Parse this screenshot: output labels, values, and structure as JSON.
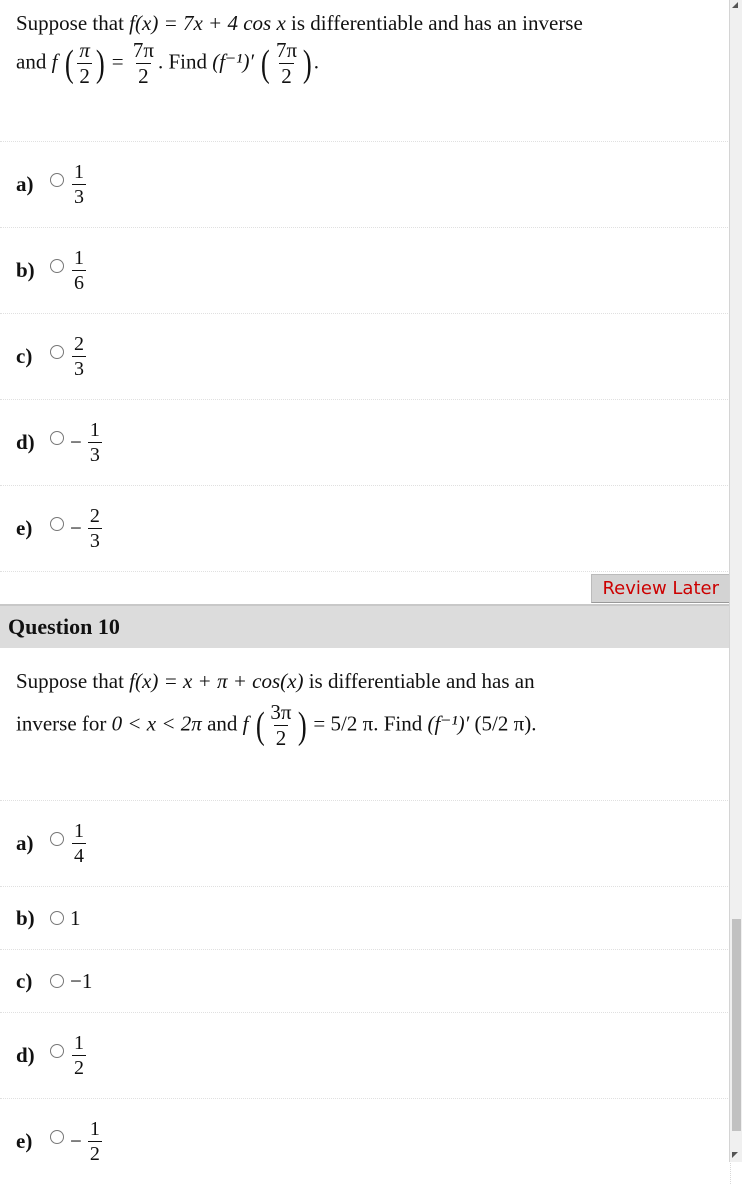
{
  "question9": {
    "stem_text_1": "Suppose that",
    "stem_func": "f(x) = 7x + 4 cos x",
    "stem_text_2": "is differentiable and has an inverse",
    "stem_line2_and": "and",
    "stem_f": "f",
    "stem_arg_num": "π",
    "stem_arg_den": "2",
    "stem_eq": "=",
    "stem_val_num": "7π",
    "stem_val_den": "2",
    "stem_find": ". Find",
    "stem_inv": "(f⁻¹)′",
    "stem_find_arg_num": "7π",
    "stem_find_arg_den": "2",
    "stem_end": ".",
    "options": [
      {
        "letter": "a)",
        "sign": "",
        "num": "1",
        "den": "3"
      },
      {
        "letter": "b)",
        "sign": "",
        "num": "1",
        "den": "6"
      },
      {
        "letter": "c)",
        "sign": "",
        "num": "2",
        "den": "3"
      },
      {
        "letter": "d)",
        "sign": "−",
        "num": "1",
        "den": "3"
      },
      {
        "letter": "e)",
        "sign": "−",
        "num": "2",
        "den": "3"
      }
    ]
  },
  "review_later_label": "Review Later",
  "question10": {
    "title": "Question 10",
    "stem_text_1": "Suppose that",
    "stem_func": "f(x) = x + π + cos(x)",
    "stem_text_2": "is differentiable and has an",
    "stem_line2_a": "inverse for",
    "stem_domain": "0 < x < 2π",
    "stem_and": "and",
    "stem_f": "f",
    "stem_arg_num": "3π",
    "stem_arg_den": "2",
    "stem_val": "= 5/2 π. Find",
    "stem_inv": "(f⁻¹)′",
    "stem_find_arg": "(5/2 π).",
    "options": [
      {
        "letter": "a)",
        "sign": "",
        "num": "1",
        "den": "4",
        "plain": ""
      },
      {
        "letter": "b)",
        "plain": "1"
      },
      {
        "letter": "c)",
        "plain": "−1"
      },
      {
        "letter": "d)",
        "sign": "",
        "num": "1",
        "den": "2",
        "plain": ""
      },
      {
        "letter": "e)",
        "sign": "−",
        "num": "1",
        "den": "2",
        "plain": ""
      }
    ]
  }
}
